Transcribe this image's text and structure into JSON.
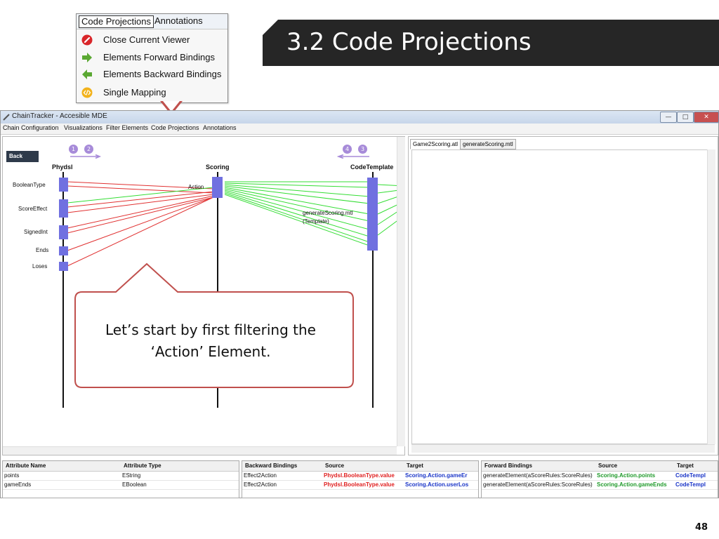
{
  "slide": {
    "title": "3.2 Code Projections",
    "page_number": "48",
    "callout_text": "Let’s start by first filtering the ‘Action’ Element."
  },
  "popup": {
    "tabs": [
      "Code Projections",
      "Annotations"
    ],
    "items": [
      {
        "label": "Close Current Viewer",
        "icon": "close-circle-icon",
        "color": "#d9262a"
      },
      {
        "label": "Elements Forward Bindings",
        "icon": "arrow-right-icon",
        "color": "#5aa832"
      },
      {
        "label": "Elements Backward Bindings",
        "icon": "arrow-left-icon",
        "color": "#5aa832"
      },
      {
        "label": "Single Mapping",
        "icon": "code-icon",
        "color": "#f2b21b"
      }
    ]
  },
  "window": {
    "title": "ChainTracker - Accesible MDE",
    "controls": [
      "minimize",
      "maximize",
      "close"
    ],
    "menu": [
      "Chain Configuration",
      "Visualizations",
      "Filter Elements",
      "Code Projections",
      "Annotations"
    ]
  },
  "viz": {
    "back_label": "Back",
    "nav_left": [
      "1",
      "2"
    ],
    "nav_right": [
      "4",
      "3"
    ],
    "columns": [
      "Phydsl",
      "Scoring",
      "CodeTemplate"
    ],
    "phydsl_elements": [
      "BooleanType",
      "ScoreEffect",
      "SignedInt",
      "Ends",
      "Loses"
    ],
    "scoring_label": "Action",
    "template_label_line1": "generateScoring.mtl",
    "template_label_line2": "(Template)",
    "colors": {
      "backward": "#e03030",
      "forward": "#33dd33",
      "bar": "#7070e0"
    }
  },
  "editor": {
    "tabs": [
      "Game2Scoring.atl",
      "generateScoring.mtl"
    ],
    "active_tab": "Game2Scoring.atl"
  },
  "attributes_table": {
    "headers": [
      "Attribute Name",
      "Attribute Type"
    ],
    "rows": [
      [
        "points",
        "EString"
      ],
      [
        "gameEnds",
        "EBoolean"
      ]
    ]
  },
  "backward_table": {
    "headers": [
      "Backward Bindings",
      "Source",
      "Target"
    ],
    "rows": [
      [
        "Effect2Action",
        "Phydsl.BooleanType.value",
        "Scoring.Action.gameEr"
      ],
      [
        "Effect2Action",
        "Phydsl.BooleanType.value",
        "Scoring.Action.userLos"
      ]
    ]
  },
  "forward_table": {
    "headers": [
      "Forward Bindings",
      "Source",
      "Target"
    ],
    "rows": [
      [
        "generateElement(aScoreRules:ScoreRules)",
        "Scoring.Action.points",
        "CodeTempl"
      ],
      [
        "generateElement(aScoreRules:ScoreRules)",
        "Scoring.Action.gameEnds",
        "CodeTempl"
      ]
    ]
  }
}
